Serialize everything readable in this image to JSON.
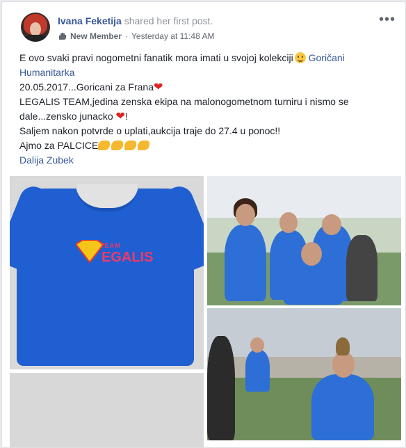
{
  "post": {
    "author": "Ivana Feketija",
    "action": "shared her first post.",
    "badge": "New Member",
    "separator": "·",
    "timestamp": "Yesterday at 11:48 AM",
    "more": "•••"
  },
  "body": {
    "line1_text": "E ovo svaki pravi nogometni fanatik mora imati u svojoj kolekciji",
    "line1_link": "Goričani Humanitarka",
    "line2": "20.05.2017...Goricani za Frana",
    "line3": "LEGALIS TEAM,jedina zenska ekipa na malonogometnom turniru i nismo se dale...zensko junacko",
    "line3_end": "!",
    "line4": "Saljem nakon potvrde o uplati,aukcija traje do 27.4 u ponoc!!",
    "line5": "Ajmo za PALCICE",
    "tagged": "Dalija Zubek"
  },
  "photos": {
    "shirt_team": "TEAM",
    "shirt_brand": "EGALIS",
    "shirt_letter": "L"
  },
  "colors": {
    "link": "#385898",
    "heart": "#e02525",
    "shirt_blue": "#1f5fd1"
  }
}
